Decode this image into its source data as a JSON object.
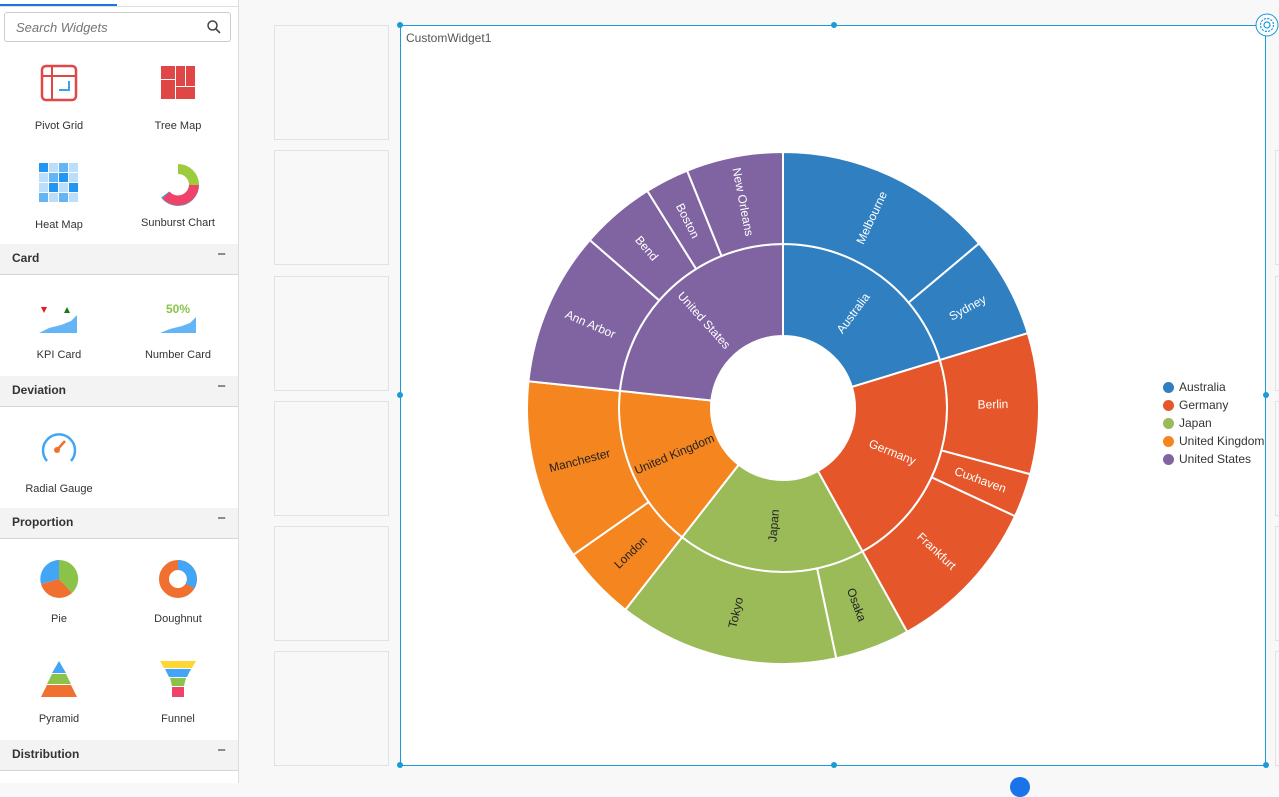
{
  "sidebar": {
    "search_placeholder": "Search Widgets",
    "widgets_top": [
      "Pivot Grid",
      "Tree Map",
      "Heat Map",
      "Sunburst Chart"
    ],
    "sections": [
      {
        "title": "Card",
        "items": [
          "KPI Card",
          "Number Card"
        ]
      },
      {
        "title": "Deviation",
        "items": [
          "Radial Gauge"
        ]
      },
      {
        "title": "Proportion",
        "items": [
          "Pie",
          "Doughnut",
          "Pyramid",
          "Funnel"
        ]
      },
      {
        "title": "Distribution",
        "items": []
      }
    ],
    "number_card_value": "50%",
    "collapse_symbol": "−"
  },
  "widget": {
    "title": "CustomWidget1"
  },
  "chart_data": {
    "type": "sunburst",
    "legend_position": "right",
    "series": [
      {
        "name": "Australia",
        "color": "#2f7fc1",
        "label_color": "#ffffff",
        "children": [
          {
            "name": "Melbourne",
            "value": 50
          },
          {
            "name": "Sydney",
            "value": 23
          }
        ]
      },
      {
        "name": "Germany",
        "color": "#e5562a",
        "label_color": "#ffffff",
        "children": [
          {
            "name": "Berlin",
            "value": 32
          },
          {
            "name": "Cuxhaven",
            "value": 10
          },
          {
            "name": "Frankfurt",
            "value": 36
          }
        ]
      },
      {
        "name": "Japan",
        "color": "#9bbb59",
        "label_color": "#222222",
        "children": [
          {
            "name": "Osaka",
            "value": 17
          },
          {
            "name": "Tokyo",
            "value": 50
          }
        ]
      },
      {
        "name": "United Kingdom",
        "color": "#f5851f",
        "label_color": "#222222",
        "children": [
          {
            "name": "London",
            "value": 17
          },
          {
            "name": "Manchester",
            "value": 41
          }
        ]
      },
      {
        "name": "United States",
        "color": "#8064a2",
        "label_color": "#ffffff",
        "children": [
          {
            "name": "Ann Arbor",
            "value": 35
          },
          {
            "name": "Bend",
            "value": 17
          },
          {
            "name": "Boston",
            "value": 10
          },
          {
            "name": "New Orleans",
            "value": 22
          }
        ]
      }
    ]
  }
}
